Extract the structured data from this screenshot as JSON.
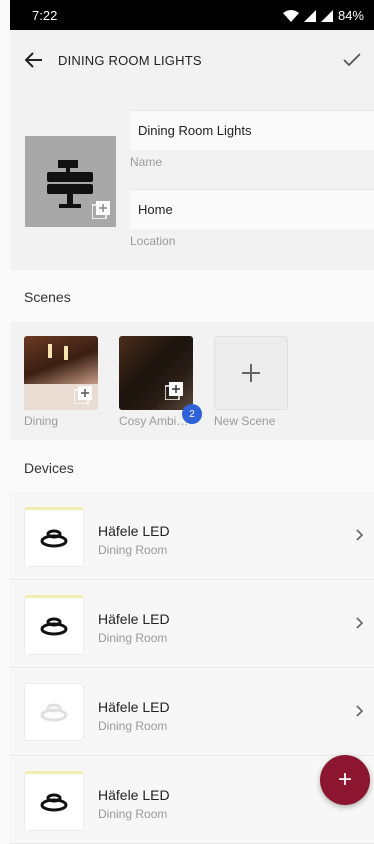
{
  "status_bar": {
    "time": "7:22",
    "battery": "84%"
  },
  "app_bar": {
    "title": "DINING ROOM LIGHTS"
  },
  "form": {
    "name_value": "Dining Room Lights",
    "name_label": "Name",
    "location_value": "Home",
    "location_label": "Location"
  },
  "scenes_section": {
    "title": "Scenes",
    "items": [
      {
        "label": "Dining"
      },
      {
        "label": "Cosy Ambi…",
        "badge": "2"
      },
      {
        "label": "New Scene"
      }
    ]
  },
  "devices_section": {
    "title": "Devices",
    "items": [
      {
        "name": "Häfele LED",
        "room": "Dining Room"
      },
      {
        "name": "Häfele LED",
        "room": "Dining Room"
      },
      {
        "name": "Häfele LED",
        "room": "Dining Room"
      },
      {
        "name": "Häfele LED",
        "room": "Dining Room"
      }
    ]
  },
  "colors": {
    "accent": "#8c1530",
    "badge": "#2f62d6"
  },
  "icons": {
    "back": "arrow-left-icon",
    "confirm": "check-icon",
    "room": "dining-table-icon",
    "add_photo": "add-photo-icon",
    "add_scene": "plus-icon",
    "light": "ceiling-light-icon",
    "chevron": "chevron-right-icon",
    "fab": "plus-icon"
  }
}
